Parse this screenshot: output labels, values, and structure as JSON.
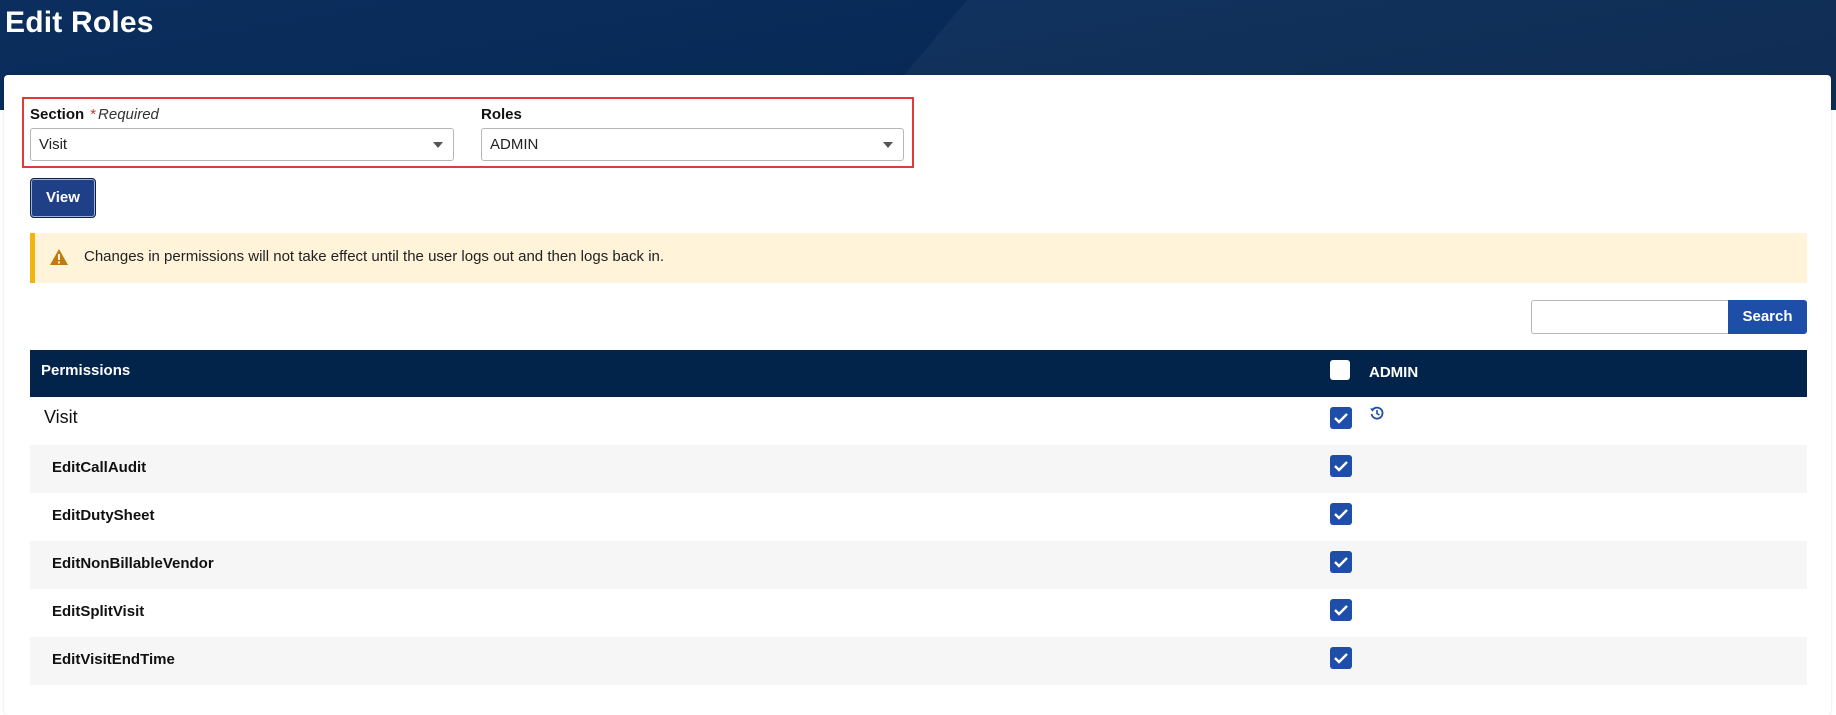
{
  "page": {
    "title": "Edit Roles"
  },
  "filters": {
    "section_label": "Section",
    "required_star": "*",
    "required_text": "Required",
    "section_value": "Visit",
    "roles_label": "Roles",
    "roles_value": "ADMIN"
  },
  "actions": {
    "view_label": "View",
    "search_label": "Search",
    "search_value": ""
  },
  "alert": {
    "text": "Changes in permissions will not take effect until the user logs out and then logs back in."
  },
  "table": {
    "permissions_header": "Permissions",
    "role_header": "ADMIN",
    "select_all_checked": false,
    "section_row": {
      "label": "Visit",
      "checked": true
    },
    "rows": [
      {
        "label": "EditCallAudit",
        "checked": true
      },
      {
        "label": "EditDutySheet",
        "checked": true
      },
      {
        "label": "EditNonBillableVendor",
        "checked": true
      },
      {
        "label": "EditSplitVisit",
        "checked": true
      },
      {
        "label": "EditVisitEndTime",
        "checked": true
      }
    ]
  },
  "icons": {
    "alert": "warning-triangle-icon",
    "history": "history-icon",
    "dropdown": "chevron-down-icon",
    "checked": "checkmark-icon"
  },
  "colors": {
    "header_bg": "#082a57",
    "primary": "#1f4ea8",
    "table_head_bg": "#02234a",
    "alert_bg": "#fff3d9",
    "alert_border": "#f2b411",
    "highlight_border": "#e03a3a"
  }
}
